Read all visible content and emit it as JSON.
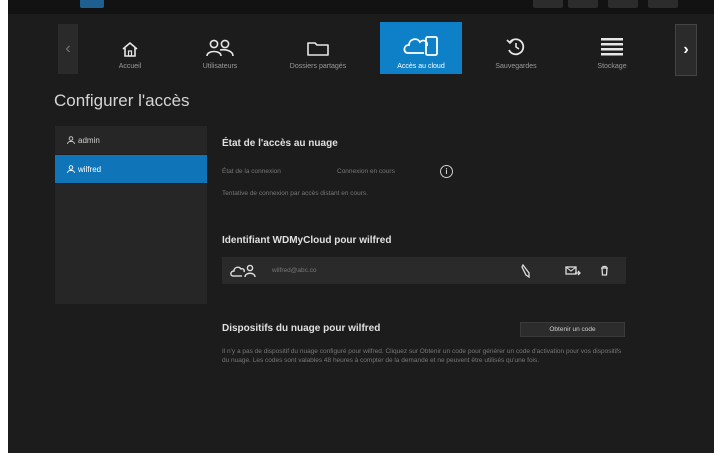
{
  "nav": {
    "items": [
      {
        "label": "Accueil"
      },
      {
        "label": "Utilisateurs"
      },
      {
        "label": "Dossiers partagés"
      },
      {
        "label": "Accès au cloud"
      },
      {
        "label": "Sauvegardes"
      },
      {
        "label": "Stockage"
      }
    ],
    "active_index": 3,
    "prev_arrow": "‹",
    "next_arrow": "›"
  },
  "page": {
    "title": "Configurer l'accès"
  },
  "users": [
    {
      "name": "admin",
      "selected": false
    },
    {
      "name": "wilfred",
      "selected": true
    }
  ],
  "cloud_status": {
    "title": "État de l'accès au nuage",
    "label": "État de la connexion",
    "value": "Connexion en cours",
    "info_icon": "i",
    "message": "Tentative de connexion par accès distant en cours."
  },
  "identifier": {
    "title": "Identifiant WDMyCloud pour wilfred",
    "email": "wilfred@abc.co"
  },
  "devices": {
    "title": "Dispositifs du nuage pour wilfred",
    "button_label": "Obtenir un code",
    "description": "Il n'y a pas de dispositif du nuage configuré pour wilfred. Cliquez sur Obtenir un code pour générer un code d'activation pour vos dispositifs du nuage. Les codes sont valables 48 heures à compter de la demande et ne peuvent être utilisés qu'une fois."
  },
  "colors": {
    "accent": "#0e80c8",
    "background": "#1c1c1c",
    "panel": "#262626"
  }
}
